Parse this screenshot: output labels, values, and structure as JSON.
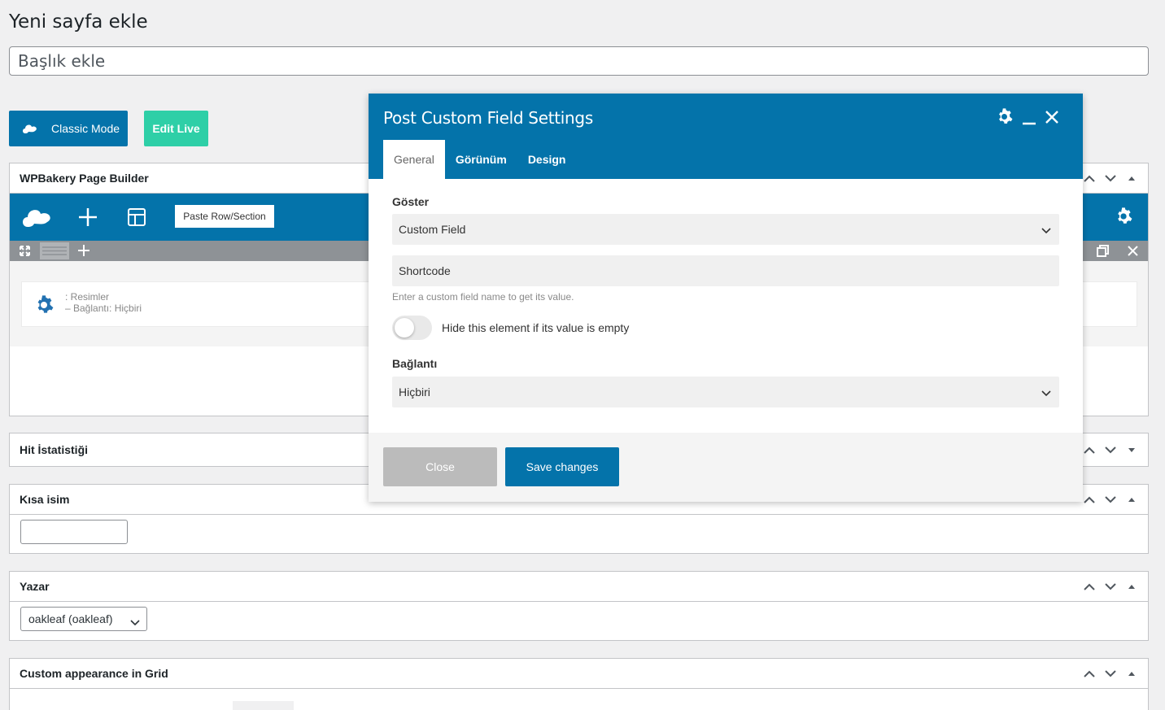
{
  "page": {
    "title": "Yeni sayfa ekle",
    "title_placeholder": "Başlık ekle"
  },
  "editor_buttons": {
    "classic_mode": "Classic Mode",
    "edit_live": "Edit Live"
  },
  "wpbakery": {
    "header": "WPBakery Page Builder",
    "paste_row": "Paste Row/Section",
    "element": {
      "line1": ": Resimler",
      "line2": "– Bağlantı: Hiçbiri"
    }
  },
  "metaboxes": {
    "hit": "Hit İstatistiği",
    "kisa_isim": "Kısa isim",
    "yazar": "Yazar",
    "yazar_value": "oakleaf (oakleaf)",
    "custom_grid": "Custom appearance in Grid"
  },
  "modal": {
    "title": "Post Custom Field Settings",
    "tabs": [
      "General",
      "Görünüm",
      "Design"
    ],
    "goster_label": "Göster",
    "goster_value": "Custom Field",
    "shortcode_value": "Shortcode",
    "help_text": "Enter a custom field name to get its value.",
    "toggle_label": "Hide this element if its value is empty",
    "baglanti_label": "Bağlantı",
    "baglanti_value": "Hiçbiri",
    "close_button": "Close",
    "save_button": "Save changes"
  },
  "colors": {
    "primary": "#0473aa",
    "edit_live": "#2ecfa7",
    "close_btn": "#bbbbbb"
  }
}
